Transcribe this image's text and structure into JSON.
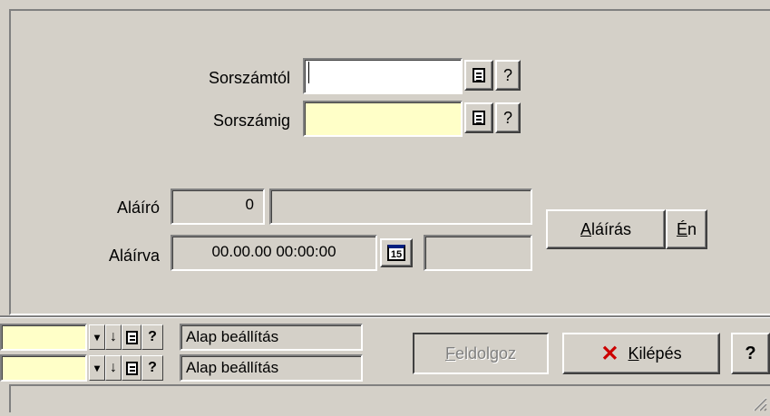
{
  "form": {
    "sorszamtol_label": "Sorszámtól",
    "sorszamig_label": "Sorszámig",
    "sorszamtol_value": "",
    "sorszamig_value": "",
    "help_glyph": "?",
    "alairo_label": "Aláíró",
    "alairo_id": "0",
    "alairo_name": "",
    "alairva_label": "Aláírva",
    "alairva_value": "00.00.00 00:00:00",
    "calendar_glyph": "15",
    "alairva_extra": ""
  },
  "buttons": {
    "alairas_pre": "",
    "alairas_u": "A",
    "alairas_post": "láírás",
    "en_u": "É",
    "en_post": "n",
    "feldolgoz_u": "F",
    "feldolgoz_post": "eldolgoz",
    "kilepes_u": "K",
    "kilepes_post": "ilépés",
    "help": "?"
  },
  "settings": {
    "rows": [
      {
        "value": "",
        "label": "Alap beállítás"
      },
      {
        "value": "",
        "label": "Alap beállítás"
      }
    ]
  },
  "colors": {
    "window_bg": "#d4d0c8",
    "yellow_field": "#ffffc8",
    "exit_icon": "#cc0000"
  },
  "icons": {
    "exit": "x-icon",
    "doc": "document-icon",
    "calendar": "calendar-icon"
  }
}
